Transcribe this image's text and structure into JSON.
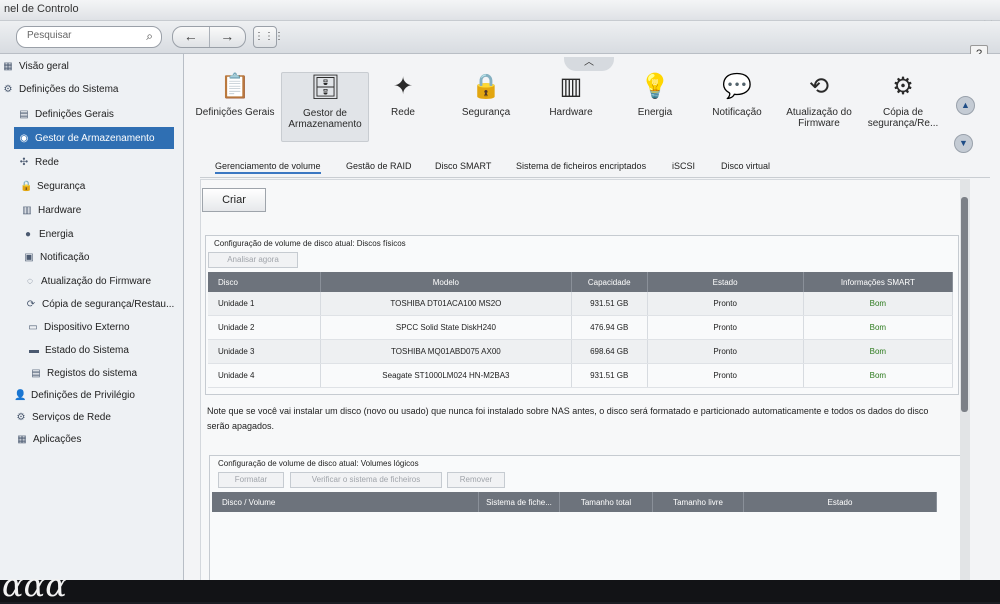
{
  "app": {
    "title": "nel de Controlo",
    "search_placeholder": "Pesquisar",
    "help": "?"
  },
  "window_controls": {
    "min": "–",
    "max": "+",
    "close": "✕"
  },
  "toolbar": {
    "back": "←",
    "forward": "→",
    "grid": "⋮⋮⋮"
  },
  "sidebar": {
    "items": [
      {
        "label": "Visão geral",
        "icon": "overview-icon",
        "glyph": "▦"
      },
      {
        "label": "Definições do Sistema",
        "icon": "gear-icon",
        "glyph": "⚙"
      },
      {
        "label": "Definições Gerais",
        "icon": "settings-icon",
        "glyph": "▤"
      },
      {
        "label": "Gestor de Armazenamento",
        "icon": "database-icon",
        "glyph": "◉"
      },
      {
        "label": "Rede",
        "icon": "network-icon",
        "glyph": "✣"
      },
      {
        "label": "Segurança",
        "icon": "lock-icon",
        "glyph": "🔒"
      },
      {
        "label": "Hardware",
        "icon": "hardware-icon",
        "glyph": "▥"
      },
      {
        "label": "Energia",
        "icon": "energy-icon",
        "glyph": "●"
      },
      {
        "label": "Notificação",
        "icon": "notification-icon",
        "glyph": "▣"
      },
      {
        "label": "Atualização do Firmware",
        "icon": "firmware-icon",
        "glyph": "◌"
      },
      {
        "label": "Cópia de segurança/Restau...",
        "icon": "backup-icon",
        "glyph": "⟳"
      },
      {
        "label": "Dispositivo Externo",
        "icon": "external-device-icon",
        "glyph": "▭"
      },
      {
        "label": "Estado do Sistema",
        "icon": "system-status-icon",
        "glyph": "▬"
      },
      {
        "label": "Registos do sistema",
        "icon": "logs-icon",
        "glyph": "▤"
      },
      {
        "label": "Definições de Privilégio",
        "icon": "privilege-icon",
        "glyph": "👤"
      },
      {
        "label": "Serviços de Rede",
        "icon": "network-services-icon",
        "glyph": "⚙"
      },
      {
        "label": "Aplicações",
        "icon": "applications-icon",
        "glyph": "▦"
      }
    ]
  },
  "apps": [
    {
      "label": "Definições Gerais",
      "icon": "general-settings-icon",
      "glyph": "📋"
    },
    {
      "label": "Gestor de Armazenamento",
      "icon": "storage-manager-icon",
      "glyph": "🗄"
    },
    {
      "label": "Rede",
      "icon": "network-icon",
      "glyph": "✦"
    },
    {
      "label": "Segurança",
      "icon": "lock-icon",
      "glyph": "🔒"
    },
    {
      "label": "Hardware",
      "icon": "hardware-icon",
      "glyph": "▥"
    },
    {
      "label": "Energia",
      "icon": "lightbulb-icon",
      "glyph": "💡"
    },
    {
      "label": "Notificação",
      "icon": "notification-icon",
      "glyph": "💬"
    },
    {
      "label": "Atualização do Firmware",
      "icon": "firmware-icon",
      "glyph": "⟲"
    },
    {
      "label": "Cópia de segurança/Re...",
      "icon": "backup-icon",
      "glyph": "⚙"
    }
  ],
  "tabs": [
    "Gerenciamento de volume",
    "Gestão de RAID",
    "Disco SMART",
    "Sistema de ficheiros encriptados",
    "iSCSI",
    "Disco virtual"
  ],
  "actions": {
    "create": "Criar",
    "analyze": "Analisar agora",
    "format": "Formatar",
    "check_fs": "Verificar o sistema de ficheiros",
    "remove": "Remover"
  },
  "physical": {
    "title": "Configuração de volume de disco atual: Discos físicos",
    "headers": [
      "Disco",
      "Modelo",
      "Capacidade",
      "Estado",
      "Informações SMART"
    ],
    "rows": [
      [
        "Unidade 1",
        "TOSHIBA DT01ACA100 MS2O",
        "931.51 GB",
        "Pronto",
        "Bom"
      ],
      [
        "Unidade 2",
        "SPCC Solid State DiskH240",
        "476.94 GB",
        "Pronto",
        "Bom"
      ],
      [
        "Unidade 3",
        "TOSHIBA MQ01ABD075 AX00",
        "698.64 GB",
        "Pronto",
        "Bom"
      ],
      [
        "Unidade 4",
        "Seagate ST1000LM024 HN-M2BA3",
        "931.51 GB",
        "Pronto",
        "Bom"
      ]
    ]
  },
  "note": "Note que se você vai instalar um disco (novo ou usado) que nunca foi instalado sobre NAS antes, o disco será formatado e particionado automaticamente e todos os dados do disco serão apagados.",
  "logical": {
    "title": "Configuração de volume de disco atual: Volumes lógicos",
    "headers": [
      "Disco / Volume",
      "Sistema de fiche...",
      "Tamanho total",
      "Tamanho livre",
      "Estado"
    ]
  },
  "colors": {
    "accent": "#2f6fb3",
    "header": "#6d737c",
    "ok": "#2c7a1d"
  }
}
